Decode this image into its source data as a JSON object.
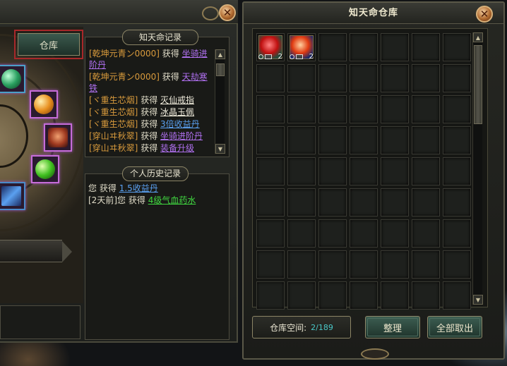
{
  "left_panel": {
    "warehouse_button": "仓库",
    "destiny_record": {
      "title": "知天命记录",
      "entries": [
        {
          "who": "[乾坤元青ン0000]",
          "verb": "获得",
          "item": "坐骑进阶丹",
          "color": "#b070f0"
        },
        {
          "who": "[乾坤元青ン0000]",
          "verb": "获得",
          "item": "天劫寒铁",
          "color": "#b070f0"
        },
        {
          "who": "[ヾ重生芯烟]",
          "verb": "获得",
          "item": "灭仙戒指",
          "color": "#f0ecdc"
        },
        {
          "who": "[ヾ重生芯烟]",
          "verb": "获得",
          "item": "冰晶玉佩",
          "color": "#f0ecdc"
        },
        {
          "who": "[ヾ重生芯烟]",
          "verb": "获得",
          "item": "3倍收益丹",
          "color": "#5aa0f0"
        },
        {
          "who": "[穿山ヰ秋翠]",
          "verb": "获得",
          "item": "坐骑进阶丹",
          "color": "#b070f0"
        },
        {
          "who": "[穿山ヰ秋翠]",
          "verb": "获得",
          "item": "装备升级",
          "color": "#b070f0"
        }
      ]
    },
    "personal_history": {
      "title": "个人历史记录",
      "entries": [
        {
          "prefix": "",
          "who": "您",
          "verb": "获得",
          "item": "1.5收益丹",
          "color": "#5aa0f0"
        },
        {
          "prefix": "[2天前]",
          "who": "您",
          "verb": "获得",
          "item": "4级气血药水",
          "color": "#40d840"
        }
      ]
    }
  },
  "warehouse": {
    "title": "知天命仓库",
    "close_label": "✕",
    "space_label": "仓库空间:",
    "space_value": "2/189",
    "sort_button": "整理",
    "take_all_button": "全部取出",
    "items": [
      {
        "slot": 0,
        "count": "2",
        "icon": "red-pill-icon"
      },
      {
        "slot": 1,
        "count": "2",
        "icon": "fire-orb-icon"
      }
    ]
  }
}
